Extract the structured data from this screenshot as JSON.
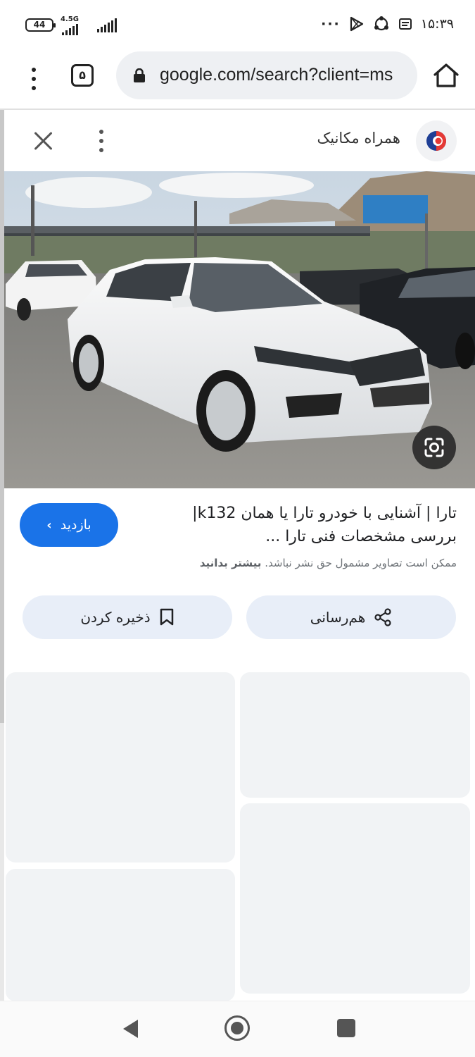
{
  "status_bar": {
    "battery": "44",
    "network": "4.5G",
    "time": "۱۵:۳۹",
    "more_dots": "···"
  },
  "browser": {
    "tab_count": "۵",
    "url": "google.com/search?client=ms"
  },
  "source": {
    "name": "همراه مکانیک"
  },
  "result": {
    "title": "تارا | آشنایی با خودرو تارا یا همان k132| بررسی مشخصات فنی تارا ...",
    "visit_label": "بازدید",
    "disclaimer_text": "ممکن است تصاویر مشمول حق نشر نباشد.",
    "disclaimer_link": "بیشتر بدانید"
  },
  "actions": {
    "share_label": "هم‌رسانی",
    "save_label": "ذخیره کردن"
  },
  "colors": {
    "accent": "#1a73e8",
    "action_bg": "#e8eef8",
    "placeholder": "#f1f3f5"
  }
}
